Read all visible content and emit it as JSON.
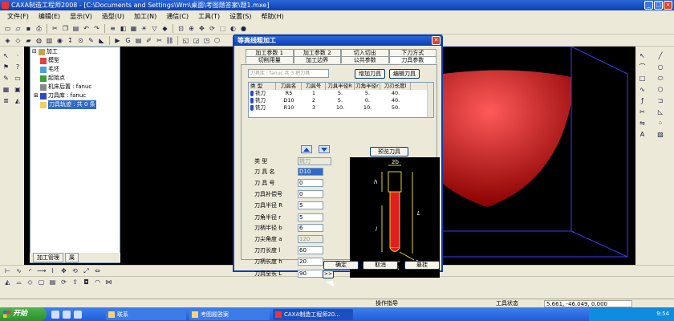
{
  "window": {
    "title": "CAXA制造工程师2008  - [C:\\Documents and Settings\\Wm\\桌面\\考图题答案\\题1.mxe]"
  },
  "menubar": [
    "文件(F)",
    "编辑(E)",
    "显示(V)",
    "造型(U)",
    "加工(N)",
    "通信(C)",
    "工具(T)",
    "设置(S)",
    "帮助(H)"
  ],
  "tree": {
    "root": "加工",
    "items": [
      {
        "label": "模型",
        "icon": "model-icon"
      },
      {
        "label": "毛坯",
        "icon": "blank-icon"
      },
      {
        "label": "起始点",
        "icon": "start-point-icon"
      },
      {
        "label": "机床后置 : fanuc",
        "icon": "machine-post-icon"
      },
      {
        "label": "刀具库 : fanuc",
        "icon": "tool-library-icon"
      },
      {
        "label": "刀具轨迹 : 共 0 条",
        "icon": "toolpath-icon"
      }
    ],
    "tabs": [
      "加工管理",
      "属"
    ]
  },
  "dialog": {
    "title": "等高线粗加工",
    "close": "✕",
    "tabs_row1": [
      "加工参数 1",
      "加工参数 2",
      "切入切出",
      "下刀方式"
    ],
    "tabs_row2": [
      "切削用量",
      "加工边界",
      "公共参数",
      "刀具参数"
    ],
    "lib_label": "刀具库 : fanuc  共 3 把刀具",
    "add_tool": "增加刀具",
    "edit_tool": "编辑刀具",
    "table": {
      "headers": [
        "类 型",
        "刀具名",
        "刀具号",
        "刀具半径R",
        "刀角半径r",
        "刀刃长度l"
      ],
      "rows": [
        [
          "铣刀",
          "R5",
          "1",
          "5.",
          "5.",
          "40."
        ],
        [
          "铣刀",
          "D10",
          "2",
          "5.",
          "0.",
          "40."
        ],
        [
          "铣刀",
          "R10",
          "3",
          "10.",
          "10.",
          "50."
        ]
      ]
    },
    "preview_button": "预览刀具",
    "params": [
      {
        "label": "类    型",
        "value": "铣刀",
        "kind": "select"
      },
      {
        "label": "刀  具  名",
        "value": "D10",
        "kind": "highlight"
      },
      {
        "label": "刀  具  号",
        "value": "0",
        "kind": "input"
      },
      {
        "label": "刀具补偿号",
        "value": "0",
        "kind": "input"
      },
      {
        "label": "刀具半径 R",
        "value": "5",
        "kind": "input"
      },
      {
        "label": "刀角半径  r",
        "value": "5",
        "kind": "input"
      },
      {
        "label": "刀柄半径 b",
        "value": "6",
        "kind": "input"
      },
      {
        "label": "刀尖角度  a",
        "value": "120",
        "kind": "disabled"
      },
      {
        "label": "刀刃长度  l",
        "value": "60",
        "kind": "input"
      },
      {
        "label": "刀柄长度 h",
        "value": "20",
        "kind": "input"
      },
      {
        "label": "刀具全长  L",
        "value": "90",
        "kind": "input"
      }
    ],
    "more": ">>",
    "preview_labels": {
      "top": "2b",
      "h": "h",
      "l": "l",
      "L": "L",
      "bottom": "2R",
      "r": "r"
    },
    "ok": "确定",
    "cancel": "取消",
    "hang": "悬挂"
  },
  "status": {
    "prompt": "操作指导",
    "tool_state": "工具状态",
    "coords": "5.661, -46.049, 0.000"
  },
  "taskbar": {
    "start": "开始",
    "items": [
      "联系",
      "考图题答案",
      "CAXA制造工程师20..."
    ],
    "clock": "9:54"
  },
  "colors": {
    "accent": "#0a3fb5",
    "tool_red": "#e02020",
    "dim_yellow": "#e6d21c"
  }
}
